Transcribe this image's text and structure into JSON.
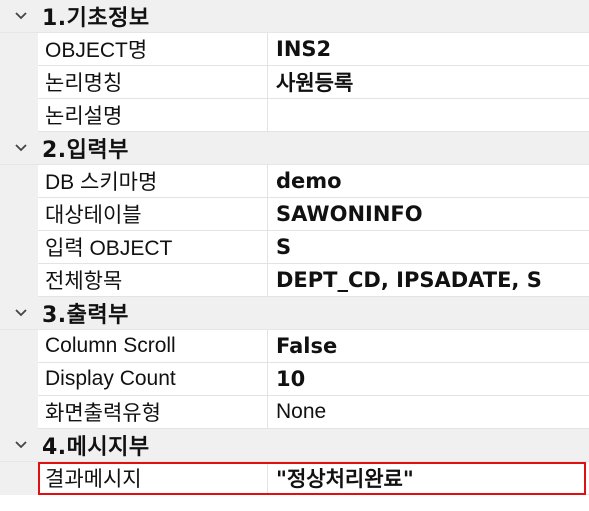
{
  "categories": [
    {
      "title": "1.기초정보",
      "rows": [
        {
          "name": "OBJECT명",
          "value": "INS2",
          "bold": true
        },
        {
          "name": "논리명칭",
          "value": "사원등록",
          "bold": true
        },
        {
          "name": "논리설명",
          "value": "",
          "bold": false
        }
      ]
    },
    {
      "title": "2.입력부",
      "rows": [
        {
          "name": "DB 스키마명",
          "value": "demo",
          "bold": true
        },
        {
          "name": "대상테이블",
          "value": "SAWONINFO",
          "bold": true
        },
        {
          "name": "입력 OBJECT",
          "value": "S",
          "bold": true
        },
        {
          "name": "전체항목",
          "value": "DEPT_CD, IPSADATE, S",
          "bold": true
        }
      ]
    },
    {
      "title": "3.출력부",
      "rows": [
        {
          "name": "Column Scroll",
          "value": "False",
          "bold": true
        },
        {
          "name": "Display Count",
          "value": "10",
          "bold": true
        },
        {
          "name": "화면출력유형",
          "value": "None",
          "bold": false
        }
      ]
    },
    {
      "title": "4.메시지부",
      "rows": [
        {
          "name": "결과메시지",
          "value": "\"정상처리완료\"",
          "bold": true,
          "selected": true
        }
      ]
    }
  ],
  "icons": {
    "expand": "chevron-down-icon"
  },
  "colors": {
    "category_bg": "#f0f0f0",
    "selection_border": "#e01010",
    "grid_line": "#e3e3e3"
  }
}
